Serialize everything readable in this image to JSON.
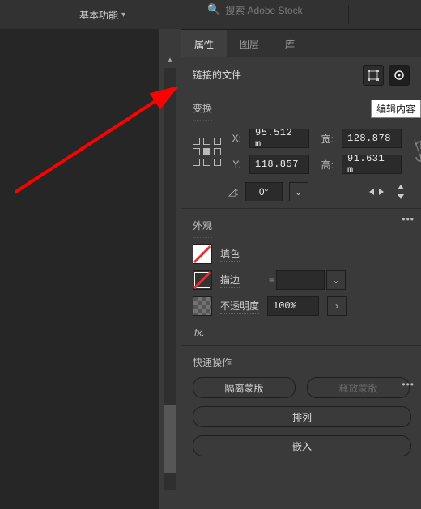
{
  "topbar": {
    "basic_label": "基本功能",
    "search_placeholder": "搜索 Adobe Stock"
  },
  "tabs": {
    "properties": "属性",
    "layers": "图层",
    "libraries": "库"
  },
  "linked_file": {
    "label": "链接的文件",
    "tooltip": "编辑内容"
  },
  "transform": {
    "title": "变换",
    "x_label": "X:",
    "y_label": "Y:",
    "w_label": "宽:",
    "h_label": "高:",
    "x": "95.512 m",
    "y": "118.857",
    "w": "128.878",
    "h": "91.631 m",
    "angle": "0°"
  },
  "appearance": {
    "title": "外观",
    "fill_label": "填色",
    "stroke_label": "描边",
    "opacity_label": "不透明度",
    "opacity_value": "100%",
    "fx_label": "fx."
  },
  "quick": {
    "title": "快速操作",
    "isolate": "隔离蒙版",
    "release": "释放蒙版",
    "arrange": "排列",
    "embed": "嵌入"
  }
}
